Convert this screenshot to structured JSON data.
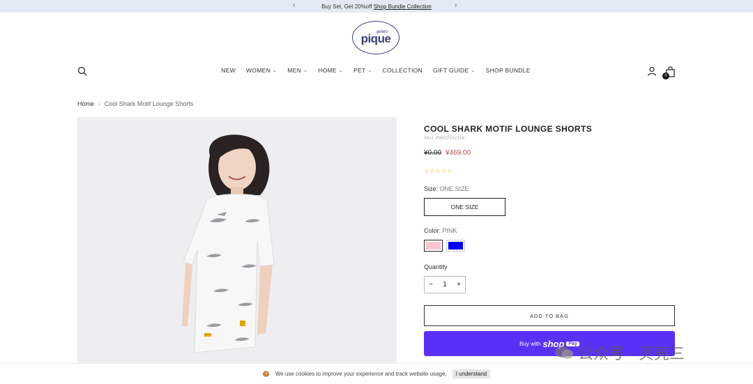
{
  "announcement": {
    "text": "Buy Set, Get 20%off",
    "link": "Shop Bundle Collection",
    "prev_icon": "chevron-left-icon",
    "next_icon": "chevron-right-icon"
  },
  "logo": {
    "small": "gelato",
    "big": "pique"
  },
  "nav": {
    "items": [
      {
        "label": "NEW",
        "dropdown": false
      },
      {
        "label": "WOMEN",
        "dropdown": true
      },
      {
        "label": "MEN",
        "dropdown": true
      },
      {
        "label": "HOME",
        "dropdown": true
      },
      {
        "label": "PET",
        "dropdown": true
      },
      {
        "label": "COLLECTION",
        "dropdown": false
      },
      {
        "label": "GIFT GUIDE",
        "dropdown": true
      },
      {
        "label": "SHOP BUNDLE",
        "dropdown": false
      }
    ],
    "cart_count": "0"
  },
  "breadcrumb": {
    "home": "Home",
    "current": "Cool Shark Motif Lounge Shorts"
  },
  "product": {
    "title": "COOL SHARK MOTIF LOUNGE SHORTS",
    "sku": "SKU: PWCP232316",
    "old_price": "¥0.00",
    "price": "¥469.00",
    "stars": "☆☆☆☆☆",
    "size_label": "Size:",
    "size_value": "ONE SIZE",
    "size_option": "ONE SIZE",
    "color_label": "Color:",
    "color_value": "PINK",
    "colors": [
      "#f6c6cf",
      "#0000ee"
    ],
    "quantity_label": "Quantity",
    "quantity": "1",
    "add_to_bag": "ADD TO BAG",
    "buy_with": "Buy with",
    "shop": "shop",
    "pay": "Pay"
  },
  "watermark": "公众号 · 贝壳三",
  "cookie": {
    "text": "We use cookies to improve your experience and track website usage.",
    "button": "I understand"
  }
}
